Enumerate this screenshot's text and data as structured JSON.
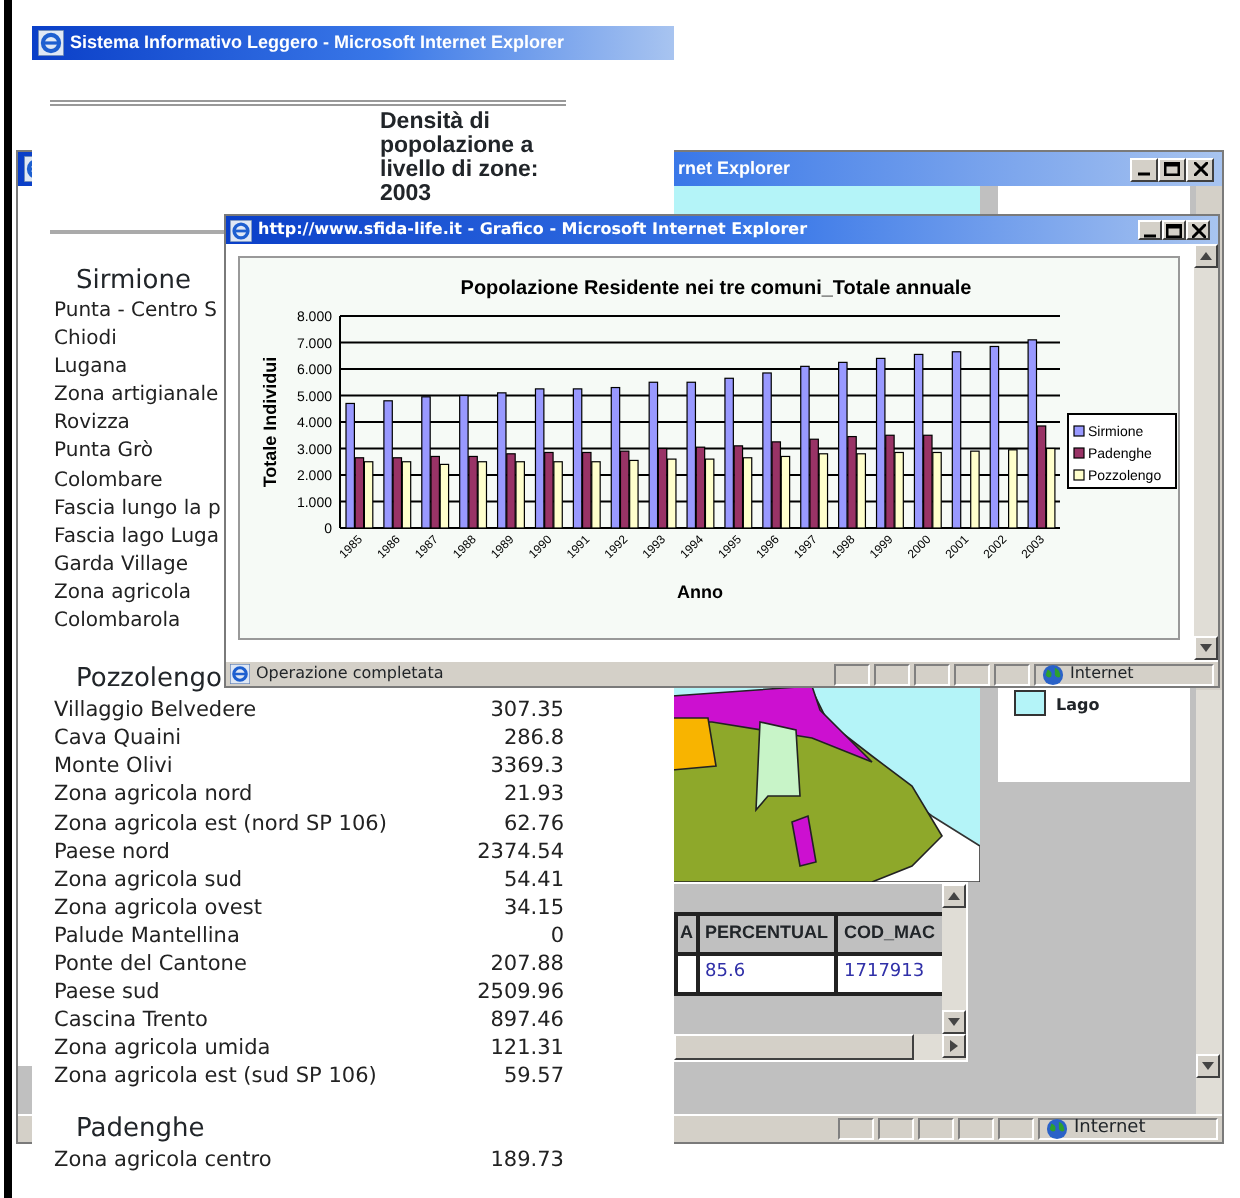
{
  "main_window": {
    "title": "Sistema Informativo Leggero - Microsoft Internet Explorer",
    "heading": "Densità di popolazione a livello di zone: 2003",
    "sections": [
      {
        "name": "Sirmione",
        "rows": [
          {
            "label": "Punta - Centro S"
          },
          {
            "label": "Chiodi"
          },
          {
            "label": "Lugana"
          },
          {
            "label": "Zona artigianale"
          },
          {
            "label": "Rovizza"
          },
          {
            "label": "Punta Grò"
          },
          {
            "label": "Colombare"
          },
          {
            "label": "Fascia lungo la p"
          },
          {
            "label": "Fascia lago Luga"
          },
          {
            "label": "Garda Village"
          },
          {
            "label": "Zona agricola"
          },
          {
            "label": "Colombarola"
          }
        ]
      },
      {
        "name": "Pozzolengo",
        "rows": [
          {
            "label": "Villaggio Belvedere",
            "value": "307.35"
          },
          {
            "label": "Cava Quaini",
            "value": "286.8"
          },
          {
            "label": "Monte Olivi",
            "value": "3369.3"
          },
          {
            "label": "Zona agricola nord",
            "value": "21.93"
          },
          {
            "label": "Zona agricola est (nord SP 106)",
            "value": "62.76"
          },
          {
            "label": "Paese nord",
            "value": "2374.54"
          },
          {
            "label": "Zona agricola sud",
            "value": "54.41"
          },
          {
            "label": "Zona agricola ovest",
            "value": "34.15"
          },
          {
            "label": "Palude Mantellina",
            "value": "0"
          },
          {
            "label": "Ponte del Cantone",
            "value": "207.88"
          },
          {
            "label": "Paese sud",
            "value": "2509.96"
          },
          {
            "label": "Cascina Trento",
            "value": "897.46"
          },
          {
            "label": "Zona agricola umida",
            "value": "121.31"
          },
          {
            "label": "Zona agricola est (sud SP 106)",
            "value": "59.57"
          }
        ]
      },
      {
        "name": "Padenghe",
        "rows": [
          {
            "label": "Zona agricola centro",
            "value": "189.73"
          }
        ]
      }
    ]
  },
  "map_window": {
    "title": "rnet Explorer",
    "legend": [
      {
        "label": "Lago",
        "color": "#b4f4f8"
      }
    ],
    "table": {
      "columns": [
        "A",
        "PERCENTUAL",
        "COD_MAC"
      ],
      "rows": [
        [
          "",
          "85.6",
          "1717913"
        ]
      ]
    },
    "zone": "Internet"
  },
  "chart_window": {
    "title": "http://www.sfida-life.it - Grafico - Microsoft Internet Explorer",
    "status_text": "Operazione completata",
    "zone": "Internet",
    "chart_data": {
      "type": "bar",
      "title": "Popolazione Residente nei tre comuni_Totale annuale",
      "xlabel": "Anno",
      "ylabel": "Totale Individui",
      "categories": [
        "1985",
        "1986",
        "1987",
        "1988",
        "1989",
        "1990",
        "1991",
        "1992",
        "1993",
        "1994",
        "1995",
        "1996",
        "1997",
        "1998",
        "1999",
        "2000",
        "2001",
        "2002",
        "2003"
      ],
      "series": [
        {
          "name": "Sirmione",
          "color": "#9999ff",
          "values": [
            4.7,
            4.8,
            4.95,
            5.0,
            5.1,
            5.25,
            5.25,
            5.3,
            5.5,
            5.5,
            5.65,
            5.85,
            6.1,
            6.25,
            6.4,
            6.55,
            6.65,
            6.85,
            7.1
          ]
        },
        {
          "name": "Padenghe",
          "color": "#993366",
          "values": [
            2.65,
            2.65,
            2.7,
            2.7,
            2.8,
            2.85,
            2.85,
            2.9,
            3.0,
            3.05,
            3.1,
            3.25,
            3.35,
            3.45,
            3.5,
            3.5,
            null,
            null,
            3.85
          ]
        },
        {
          "name": "Pozzolengo",
          "color": "#ffffcc",
          "values": [
            2.5,
            2.5,
            2.4,
            2.5,
            2.5,
            2.5,
            2.5,
            2.55,
            2.6,
            2.6,
            2.65,
            2.7,
            2.8,
            2.8,
            2.85,
            2.85,
            2.9,
            2.95,
            3.0
          ]
        }
      ],
      "ylim": [
        0,
        8
      ],
      "grid": true,
      "legend": true,
      "yticks": [
        {
          "value": 0,
          "label": "0"
        },
        {
          "value": 1,
          "label": "1.000"
        },
        {
          "value": 2,
          "label": "2.000"
        },
        {
          "value": 3,
          "label": "3.000"
        },
        {
          "value": 4,
          "label": "4.000"
        },
        {
          "value": 5,
          "label": "5.000"
        },
        {
          "value": 6,
          "label": "6.000"
        },
        {
          "value": 7,
          "label": "7.000"
        },
        {
          "value": 8,
          "label": "8.000"
        }
      ]
    }
  }
}
